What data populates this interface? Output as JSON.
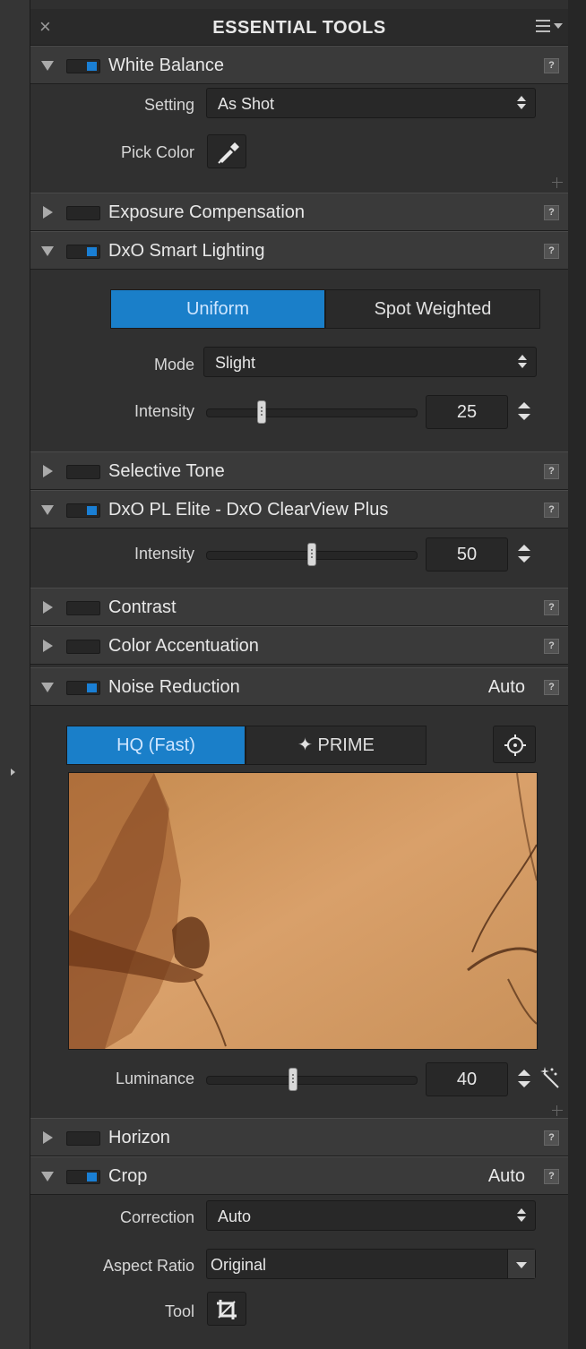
{
  "panel": {
    "title": "ESSENTIAL TOOLS"
  },
  "sections": {
    "white_balance": {
      "label": "White Balance",
      "enabled": true,
      "setting_label": "Setting",
      "setting_value": "As Shot",
      "pick_color_label": "Pick Color"
    },
    "exposure": {
      "label": "Exposure Compensation",
      "enabled": false
    },
    "smart_lighting": {
      "label": "DxO Smart Lighting",
      "enabled": true,
      "seg_uniform": "Uniform",
      "seg_spot": "Spot Weighted",
      "mode_label": "Mode",
      "mode_value": "Slight",
      "intensity_label": "Intensity",
      "intensity_value": "25"
    },
    "selective_tone": {
      "label": "Selective Tone",
      "enabled": false
    },
    "clearview": {
      "label": "DxO PL Elite - DxO ClearView Plus",
      "enabled": true,
      "intensity_label": "Intensity",
      "intensity_value": "50"
    },
    "contrast": {
      "label": "Contrast",
      "enabled": false
    },
    "color_accent": {
      "label": "Color Accentuation",
      "enabled": false
    },
    "noise": {
      "label": "Noise Reduction",
      "enabled": true,
      "auto": "Auto",
      "seg_hq": "HQ (Fast)",
      "seg_prime": "✦  PRIME",
      "luminance_label": "Luminance",
      "luminance_value": "40"
    },
    "horizon": {
      "label": "Horizon",
      "enabled": false
    },
    "crop": {
      "label": "Crop",
      "enabled": true,
      "auto": "Auto",
      "correction_label": "Correction",
      "correction_value": "Auto",
      "aspect_label": "Aspect Ratio",
      "aspect_value": "Original",
      "tool_label": "Tool"
    }
  },
  "help_glyph": "?",
  "close_glyph": "×",
  "colors": {
    "accent": "#1a7fc9",
    "panel_bg": "#303030",
    "header_bg": "#3a3a3a"
  },
  "icons": [
    "close-icon",
    "panel-menu-icon",
    "eyedropper-icon",
    "target-icon",
    "magic-wand-icon",
    "crop-tool-icon",
    "help-icon"
  ]
}
